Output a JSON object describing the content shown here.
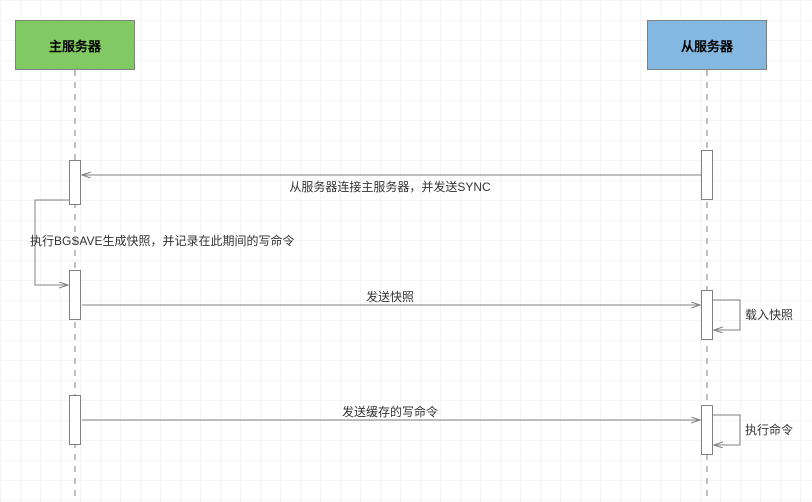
{
  "participants": {
    "master": "主服务器",
    "slave": "从服务器"
  },
  "messages": {
    "m1": "从服务器连接主服务器，并发送SYNC",
    "m2": "执行BGSAVE生成快照，并记录在此期间的写命令",
    "m3": "发送快照",
    "m4": "载入快照",
    "m5": "发送缓存的写命令",
    "m6": "执行命令"
  },
  "chart_data": {
    "type": "sequence",
    "participants": [
      {
        "id": "master",
        "label": "主服务器"
      },
      {
        "id": "slave",
        "label": "从服务器"
      }
    ],
    "messages": [
      {
        "from": "slave",
        "to": "master",
        "text": "从服务器连接主服务器，并发送SYNC"
      },
      {
        "from": "master",
        "to": "master",
        "text": "执行BGSAVE生成快照，并记录在此期间的写命令"
      },
      {
        "from": "master",
        "to": "slave",
        "text": "发送快照"
      },
      {
        "from": "slave",
        "to": "slave",
        "text": "载入快照"
      },
      {
        "from": "master",
        "to": "slave",
        "text": "发送缓存的写命令"
      },
      {
        "from": "slave",
        "to": "slave",
        "text": "执行命令"
      }
    ]
  }
}
